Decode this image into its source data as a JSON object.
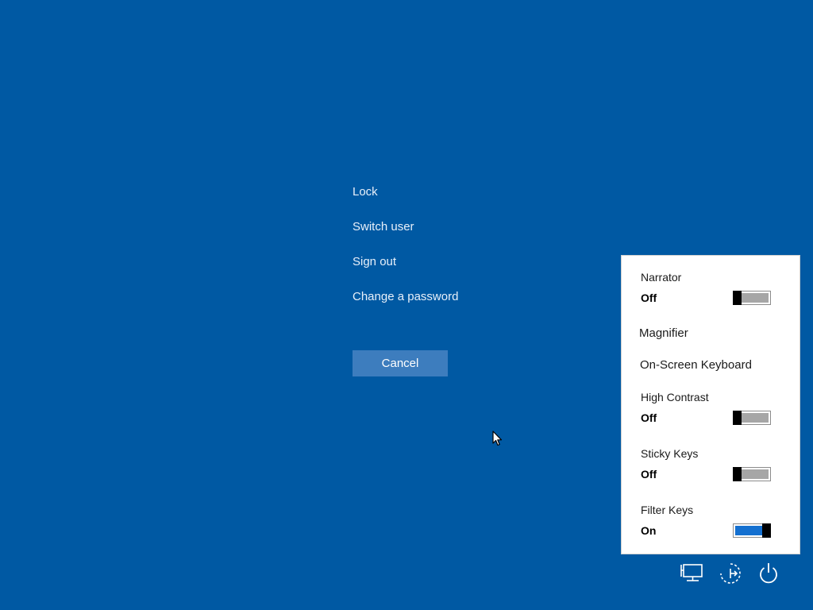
{
  "menu": {
    "items": [
      {
        "label": "Lock"
      },
      {
        "label": "Switch user"
      },
      {
        "label": "Sign out"
      },
      {
        "label": "Change a password"
      }
    ],
    "cancel_label": "Cancel"
  },
  "ease_of_access": {
    "narrator": {
      "label": "Narrator",
      "state": "Off",
      "on": false
    },
    "magnifier": {
      "label": "Magnifier"
    },
    "on_screen_keyboard": {
      "label": "On-Screen Keyboard"
    },
    "high_contrast": {
      "label": "High Contrast",
      "state": "Off",
      "on": false
    },
    "sticky_keys": {
      "label": "Sticky Keys",
      "state": "Off",
      "on": false
    },
    "filter_keys": {
      "label": "Filter Keys",
      "state": "On",
      "on": true
    }
  },
  "system_icons": [
    {
      "icon": "network-icon"
    },
    {
      "icon": "ease-of-access-icon"
    },
    {
      "icon": "power-icon"
    }
  ],
  "colors": {
    "background": "#0059a3",
    "cancel_button": "#3d7dbe",
    "toggle_on": "#1470d0",
    "toggle_off": "#a6a6a6"
  }
}
